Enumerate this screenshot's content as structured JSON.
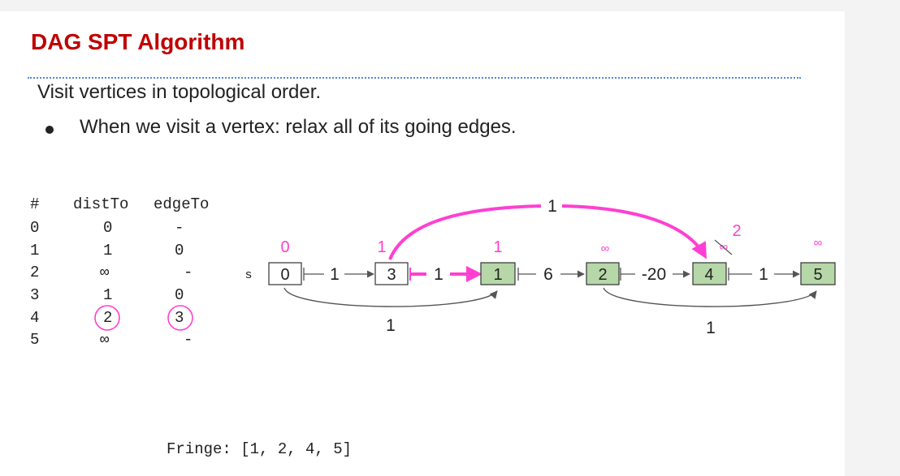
{
  "slide": {
    "title": "DAG SPT Algorithm",
    "line1": "Visit vertices in topological order.",
    "bullet": "When we visit a vertex: relax all of its going edges."
  },
  "table": {
    "headers": {
      "num": "#",
      "distTo": "distTo",
      "edgeTo": "edgeTo"
    },
    "rows": [
      {
        "num": "0",
        "distTo": "0",
        "edgeTo": "-"
      },
      {
        "num": "1",
        "distTo": "1",
        "edgeTo": "0"
      },
      {
        "num": "2",
        "distTo": "∞",
        "edgeTo": "-"
      },
      {
        "num": "3",
        "distTo": "1",
        "edgeTo": "0"
      },
      {
        "num": "4",
        "distTo": "2",
        "edgeTo": "3"
      },
      {
        "num": "5",
        "distTo": "∞",
        "edgeTo": "-"
      }
    ]
  },
  "graph": {
    "source_label": "s",
    "vertices": [
      {
        "id": "0",
        "dist": "0"
      },
      {
        "id": "3",
        "dist": "1"
      },
      {
        "id": "1",
        "dist": "1"
      },
      {
        "id": "2",
        "dist": "∞"
      },
      {
        "id": "4",
        "dist": "∞",
        "new_dist": "2"
      },
      {
        "id": "5",
        "dist": "∞"
      }
    ],
    "edge_weights": {
      "e0_3": "1",
      "e3_1": "1",
      "e1_2": "6",
      "e2_4": "-20",
      "e4_5": "1",
      "e0_1": "1",
      "e2_5": "1",
      "e3_4": "1"
    },
    "colors": {
      "highlight": "#ff3fd2",
      "visited_fill": "#b6d7a8",
      "arrow": "#555555"
    }
  },
  "fringe": "Fringe: [1, 2, 4, 5]"
}
